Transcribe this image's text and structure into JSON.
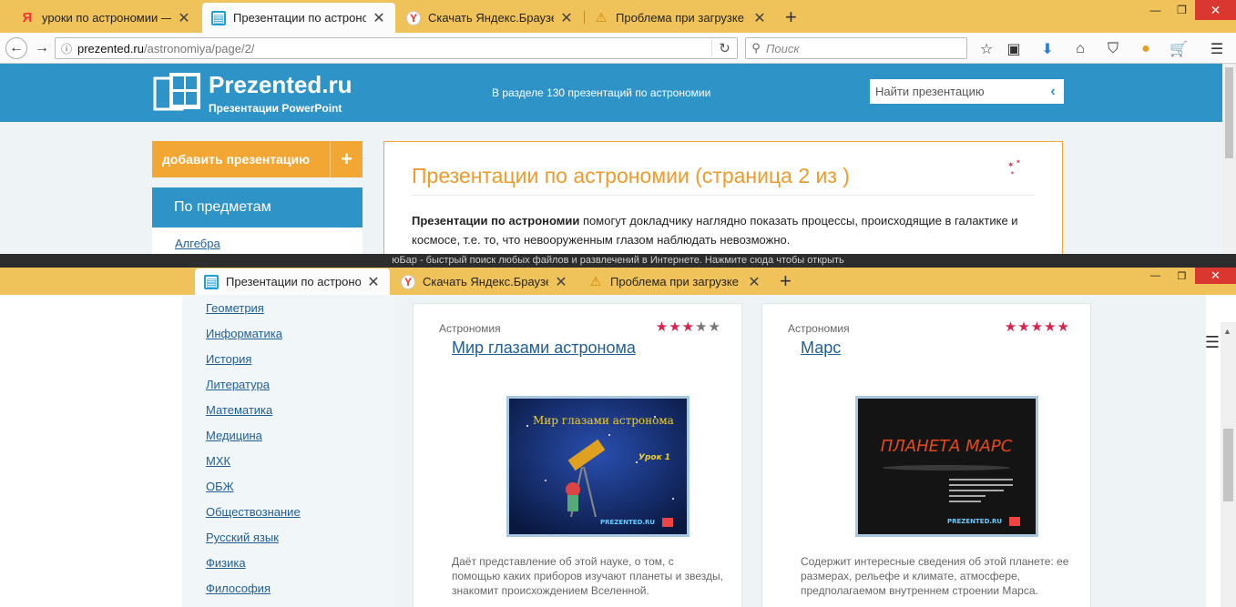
{
  "window1": {
    "tabs": [
      {
        "title": "уроки по астрономии — Ян"
      },
      {
        "title": "Презентации по астрономи"
      },
      {
        "title": "Скачать Яндекс.Браузер"
      },
      {
        "title": "Проблема при загрузке стр"
      }
    ],
    "new_tab": "+",
    "url_host": "prezented.ru",
    "url_path": "/astronomiya/page/2/",
    "search_placeholder": "Поиск"
  },
  "site": {
    "logo_title": "Prezented.ru",
    "logo_subtitle": "Презентации PowerPoint",
    "header_count": "В разделе 130 презентаций по астрономии",
    "search_placeholder": "Найти презентацию",
    "add_button": "добавить презентацию",
    "add_plus": "+",
    "subjects_heading": "По предметам",
    "first_subject": "Алгебра",
    "page_title": "Презентации по астрономии (страница 2 из )",
    "intro_bold": "Презентации по астрономии",
    "intro_rest": " помогут докладчику наглядно показать процессы, происходящие в галактике и космосе, т.е. то, что невооруженным глазом наблюдать невозможно."
  },
  "notification": "юБар - быстрый поиск любых файлов и развлечений в Интернете. Нажмите сюда чтобы открыть",
  "window2": {
    "tabs": [
      {
        "title": "Презентации по астрономи"
      },
      {
        "title": "Скачать Яндекс.Браузер"
      },
      {
        "title": "Проблема при загрузке стр"
      }
    ],
    "new_tab": "+",
    "subjects": [
      "Геометрия",
      "Информатика",
      "История",
      "Литература",
      "Математика",
      "Медицина",
      "МХК",
      "ОБЖ",
      "Обществознание",
      "Русский язык",
      "Физика",
      "Философия"
    ],
    "cards": [
      {
        "category": "Астрономия",
        "rating": 3,
        "max_rating": 5,
        "title": "Мир глазами астронома",
        "thumb_heading": "Мир глазами астронома",
        "thumb_sub": "Урок 1",
        "thumb_brand": "PREZENTED.RU",
        "description": "Даёт представление об этой науке, о том, с помощью каких приборов изучают планеты и звезды, знакомит происхождением Вселенной."
      },
      {
        "category": "Астрономия",
        "rating": 5,
        "max_rating": 5,
        "title": "Марс",
        "thumb_heading": "ПЛАНЕТА МАРС",
        "thumb_brand": "PREZENTED.RU",
        "description": "Содержит интересные сведения об этой планете: ее размерах, рельефе и климате, атмосфере, предполагаемом внутреннем строении Марса."
      }
    ]
  },
  "colors": {
    "tabbar": "#f0c35a",
    "site_blue": "#2e94c8",
    "accent_orange": "#f2a633",
    "title_orange": "#ef9a2a",
    "star_on": "#d8244d",
    "close_red": "#d9372f"
  }
}
